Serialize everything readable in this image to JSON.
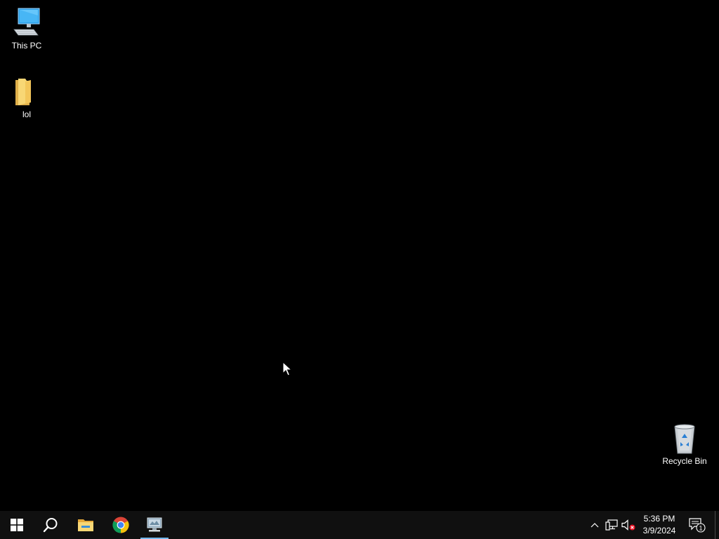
{
  "desktop": {
    "icons": [
      {
        "label": "This PC",
        "icon": "this-pc-icon"
      },
      {
        "label": "lol",
        "icon": "folder-icon"
      },
      {
        "label": "Recycle Bin",
        "icon": "recycle-bin-icon"
      }
    ]
  },
  "taskbar": {
    "buttons": [
      {
        "icon": "windows-start-icon"
      },
      {
        "icon": "search-icon"
      },
      {
        "icon": "file-explorer-icon"
      },
      {
        "icon": "chrome-icon"
      },
      {
        "icon": "remote-desktop-app-icon",
        "active": true
      }
    ],
    "tray": {
      "icons": [
        "chevron-up-icon",
        "network-icon",
        "volume-muted-icon"
      ],
      "time": "5:36 PM",
      "date": "3/9/2024",
      "notification_count": "1"
    }
  },
  "colors": {
    "desktop_background": "#000000",
    "taskbar_background": "#101010",
    "active_indicator": "#76b9ed",
    "folder_yellow": "#f8d775"
  }
}
